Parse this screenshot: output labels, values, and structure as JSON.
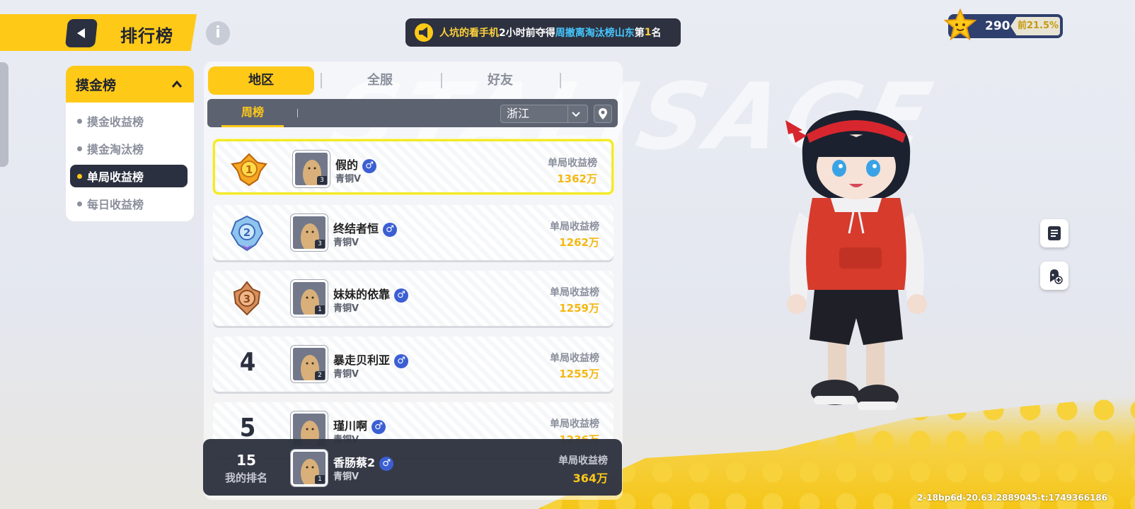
{
  "header": {
    "title": "排行榜",
    "info_icon": "i",
    "broadcast": {
      "player": "人坑的看手机",
      "time": "2小时前夺得",
      "board": "周撤离淘汰榜山东",
      "rank_prefix": "第",
      "rank_num": "1",
      "rank_suffix": "名"
    },
    "score": {
      "value": "290",
      "percent": "前21.5%"
    }
  },
  "categories": {
    "title": "摸金榜",
    "items": [
      {
        "label": "摸金收益榜",
        "active": false
      },
      {
        "label": "摸金淘汰榜",
        "active": false
      },
      {
        "label": "单局收益榜",
        "active": true
      },
      {
        "label": "每日收益榜",
        "active": false
      }
    ]
  },
  "tabs": [
    {
      "label": "地区"
    },
    {
      "label": "全服"
    },
    {
      "label": "好友"
    }
  ],
  "subtabs": {
    "active": "周榜",
    "region": "浙江"
  },
  "rows": [
    {
      "rank": "1",
      "name": "假的",
      "gender": "♂",
      "tier": "青铜V",
      "level": "3",
      "metric_label": "单局收益榜",
      "value": "1362万"
    },
    {
      "rank": "2",
      "name": "终结者恒",
      "gender": "♂",
      "tier": "青铜V",
      "level": "3",
      "metric_label": "单局收益榜",
      "value": "1262万"
    },
    {
      "rank": "3",
      "name": "妹妹的依靠",
      "gender": "♂",
      "tier": "青铜V",
      "level": "1",
      "metric_label": "单局收益榜",
      "value": "1259万"
    },
    {
      "rank": "4",
      "name": "暴走贝利亚",
      "gender": "♂",
      "tier": "青铜V",
      "level": "2",
      "metric_label": "单局收益榜",
      "value": "1255万"
    },
    {
      "rank": "5",
      "name": "瑾川啊",
      "gender": "♂",
      "tier": "青铜V",
      "level": "",
      "metric_label": "单局收益榜",
      "value": "1236万"
    }
  ],
  "my_rank": {
    "rank": "15",
    "label": "我的排名",
    "name": "香肠蔡2",
    "gender": "♂",
    "tier": "青铜V",
    "level": "1",
    "metric_label": "单局收益榜",
    "value": "364万"
  },
  "side_buttons": [
    "notes-icon",
    "add-friend-icon"
  ],
  "build_id": "2-18bp6d-20.63.2889045-t:1749366186",
  "colors": {
    "accent": "#ffc918",
    "dark": "#2b3040",
    "gender": "#3b5fd3",
    "value": "#f4b812"
  }
}
